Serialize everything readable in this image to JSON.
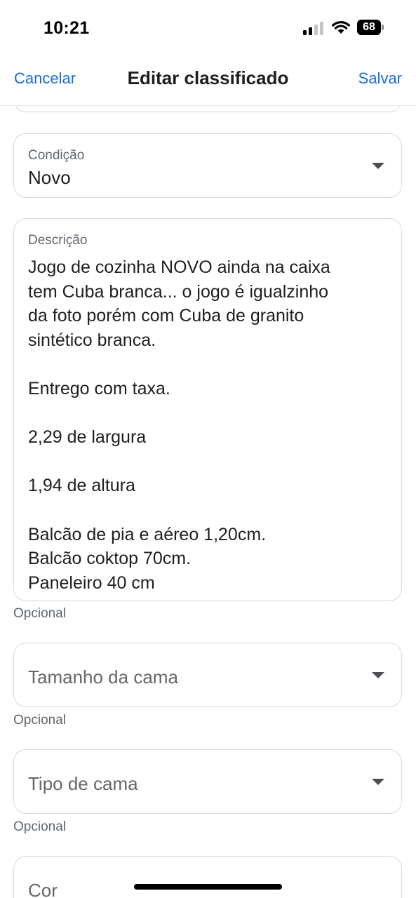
{
  "status_bar": {
    "time": "10:21",
    "battery_level": "68",
    "icons": [
      "signal-icon",
      "wifi-icon",
      "battery-icon"
    ]
  },
  "nav": {
    "cancel_label": "Cancelar",
    "title": "Editar classificado",
    "save_label": "Salvar"
  },
  "fields": {
    "condition": {
      "label": "Condição",
      "value": "Novo"
    },
    "description": {
      "label": "Descrição",
      "value": "Jogo de cozinha NOVO ainda na caixa\ntem Cuba branca... o jogo é igualzinho\nda foto porém com Cuba de granito\nsintético branca.\n\nEntrego com taxa.\n\n2,29 de largura\n\n1,94 de altura\n\nBalcão de pia e aéreo 1,20cm.\nBalcão coktop 70cm.\nPaneleiro 40 cm",
      "helper": "Opcional"
    },
    "bed_size": {
      "placeholder": "Tamanho da cama",
      "helper": "Opcional"
    },
    "bed_type": {
      "placeholder": "Tipo de cama",
      "helper": "Opcional"
    },
    "color": {
      "placeholder": "Cor"
    }
  },
  "colors": {
    "accent": "#1a6ed8",
    "border": "#d6d8dc",
    "text": "#1c1e21",
    "muted": "#606770"
  }
}
